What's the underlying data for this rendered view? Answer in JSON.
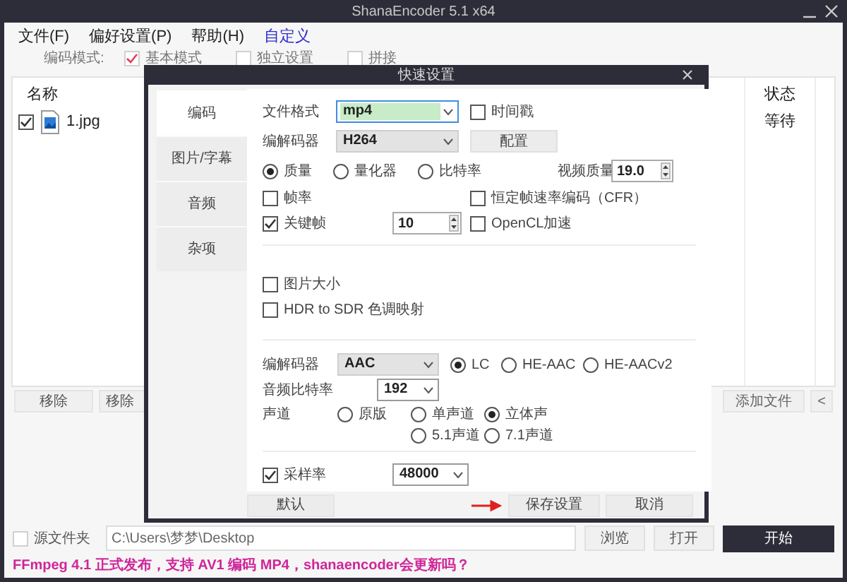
{
  "window": {
    "title": "ShanaEncoder 5.1 x64"
  },
  "menu": [
    {
      "label": "文件(F)",
      "kind": "menu"
    },
    {
      "label": "偏好设置(P)",
      "kind": "menu"
    },
    {
      "label": "帮助(H)",
      "kind": "menu"
    },
    {
      "label": "自定义",
      "kind": "link"
    }
  ],
  "encode_mode": {
    "label": "编码模式:",
    "options": [
      {
        "label": "基本模式",
        "checked": true
      },
      {
        "label": "独立设置",
        "checked": false
      },
      {
        "label": "拼接",
        "checked": false
      }
    ]
  },
  "file_table": {
    "columns": [
      "名称",
      "状态"
    ],
    "rows": [
      {
        "name": "1.jpg",
        "checked": true,
        "status": "等待"
      }
    ]
  },
  "list_buttons_left": [
    "移除",
    "移除"
  ],
  "list_buttons_right": [
    "添加文件",
    "<"
  ],
  "output": {
    "source_folder": {
      "label": "源文件夹",
      "checked": false
    },
    "path": "C:\\Users\\梦梦\\Desktop",
    "buttons": [
      {
        "label": "浏览",
        "kind": "normal"
      },
      {
        "label": "打开",
        "kind": "normal"
      },
      {
        "label": "开始",
        "kind": "primary"
      }
    ]
  },
  "footer_text": "FFmpeg 4.1 正式发布，支持 AV1 编码 MP4，shanaencoder会更新吗？",
  "dialog": {
    "title": "快速设置",
    "tabs": [
      {
        "label": "编码",
        "selected": true
      },
      {
        "label": "图片/字幕",
        "selected": false
      },
      {
        "label": "音频",
        "selected": false
      },
      {
        "label": "杂项",
        "selected": false
      }
    ],
    "sections": [
      {
        "rows": [
          [
            {
              "kind": "label",
              "text": "文件格式"
            },
            {
              "kind": "combo",
              "value": "mp4",
              "focused": true
            },
            {
              "kind": "checkbox",
              "label": "时间戳",
              "checked": false
            }
          ],
          [
            {
              "kind": "label",
              "text": "编解码器"
            },
            {
              "kind": "dropdown",
              "value": "H264",
              "focused": false
            },
            {
              "kind": "button",
              "label": "配置"
            }
          ],
          [
            {
              "kind": "radio",
              "label": "质量",
              "selected": true
            },
            {
              "kind": "radio",
              "label": "量化器",
              "selected": false
            },
            {
              "kind": "radio",
              "label": "比特率",
              "selected": false
            },
            {
              "kind": "label",
              "text": "视频质量"
            },
            {
              "kind": "spin",
              "value": "19.0"
            }
          ],
          [
            {
              "kind": "checkbox",
              "label": "帧率",
              "checked": false
            },
            "",
            {
              "kind": "checkbox",
              "label": "恒定帧速率编码（CFR）",
              "checked": false
            }
          ],
          [
            {
              "kind": "checkbox",
              "label": "关键帧",
              "checked": true
            },
            {
              "kind": "spin",
              "value": "10"
            },
            {
              "kind": "checkbox",
              "label": "OpenCL加速",
              "checked": false
            }
          ]
        ]
      },
      {
        "rows": [
          [
            {
              "kind": "checkbox",
              "label": "图片大小",
              "checked": false
            }
          ],
          [
            {
              "kind": "checkbox",
              "label": "HDR to SDR 色调映射",
              "checked": false
            }
          ]
        ]
      },
      {
        "rows": [
          [
            {
              "kind": "label",
              "text": "编解码器"
            },
            {
              "kind": "dropdown",
              "value": "AAC",
              "focused": false
            },
            {
              "kind": "radio",
              "label": "LC",
              "selected": true
            },
            {
              "kind": "radio",
              "label": "HE-AAC",
              "selected": false
            },
            {
              "kind": "radio",
              "label": "HE-AACv2",
              "selected": false
            }
          ],
          [
            {
              "kind": "label",
              "text": "音频比特率"
            },
            {
              "kind": "combo",
              "value": "192",
              "focused": false
            }
          ],
          [
            {
              "kind": "label",
              "text": "声道"
            },
            {
              "kind": "radio",
              "label": "原版",
              "selected": false
            },
            {
              "kind": "radio",
              "label": "单声道",
              "selected": false
            },
            {
              "kind": "radio",
              "label": "立体声",
              "selected": true
            }
          ],
          [
            "",
            "",
            {
              "kind": "radio",
              "label": "5.1声道",
              "selected": false
            },
            {
              "kind": "radio",
              "label": "7.1声道",
              "selected": false
            }
          ]
        ]
      },
      {
        "rows": [
          [
            {
              "kind": "checkbox",
              "label": "采样率",
              "checked": true
            },
            {
              "kind": "combo",
              "value": "48000",
              "focused": false
            }
          ]
        ]
      }
    ],
    "buttons": [
      {
        "label": "默认",
        "marked": false
      },
      {
        "label": "保存设置",
        "marked": true
      },
      {
        "label": "取消",
        "marked": false
      }
    ]
  }
}
